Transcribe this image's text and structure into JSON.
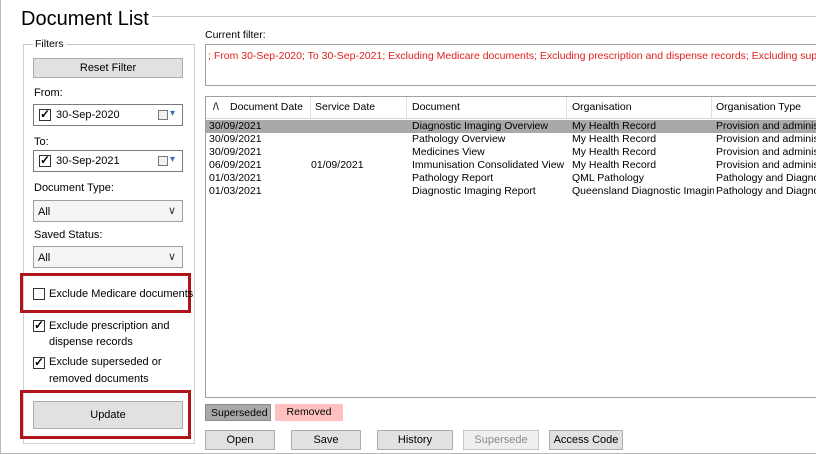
{
  "page": {
    "title": "Document List"
  },
  "filters": {
    "legend": "Filters",
    "reset_button": "Reset Filter",
    "from_label": "From:",
    "from_value": "30-Sep-2020",
    "to_label": "To:",
    "to_value": "30-Sep-2021",
    "doc_type_label": "Document Type:",
    "doc_type_value": "All",
    "saved_status_label": "Saved Status:",
    "saved_status_value": "All",
    "exclude_medicare": {
      "label": "Exclude Medicare documents",
      "checked": false
    },
    "exclude_prescription": {
      "label_line1": "Exclude prescription and",
      "label_line2": "dispense records",
      "checked": true
    },
    "exclude_superseded": {
      "label_line1": "Exclude superseded or",
      "label_line2": "removed documents",
      "checked": true
    },
    "update_button": "Update"
  },
  "current_filter": {
    "label": "Current filter:",
    "text": "; From 30-Sep-2020; To 30-Sep-2021; Excluding Medicare documents; Excluding prescription and dispense records; Excluding supersed"
  },
  "table": {
    "sort_indicator": "/\\",
    "headers": [
      "Document Date",
      "Service Date",
      "Document",
      "Organisation",
      "Organisation Type"
    ],
    "rows": [
      [
        "30/09/2021",
        "",
        "Diagnostic Imaging Overview",
        "My Health Record",
        "Provision and administ"
      ],
      [
        "30/09/2021",
        "",
        "Pathology Overview",
        "My Health Record",
        "Provision and administ"
      ],
      [
        "30/09/2021",
        "",
        "Medicines View",
        "My Health Record",
        "Provision and administ"
      ],
      [
        "06/09/2021",
        "01/09/2021",
        "Immunisation Consolidated View",
        "My Health Record",
        "Provision and administ"
      ],
      [
        "01/03/2021",
        "",
        "Pathology Report",
        "QML Pathology",
        "Pathology and Diagno"
      ],
      [
        "01/03/2021",
        "",
        "Diagnostic Imaging Report",
        "Queensland Diagnostic Imaging",
        "Pathology and Diagno"
      ]
    ],
    "selected_row": 0
  },
  "legend": {
    "superseded": "Superseded",
    "removed": "Removed"
  },
  "actions": {
    "open": "Open",
    "save": "Save",
    "history": "History",
    "supersede": "Supersede",
    "access_code": "Access Code"
  },
  "colors": {
    "highlight_box": "#b0141a",
    "filter_text": "#e02020",
    "removed_bg": "#ffc0c0",
    "superseded_bg": "#a9a9a9"
  }
}
